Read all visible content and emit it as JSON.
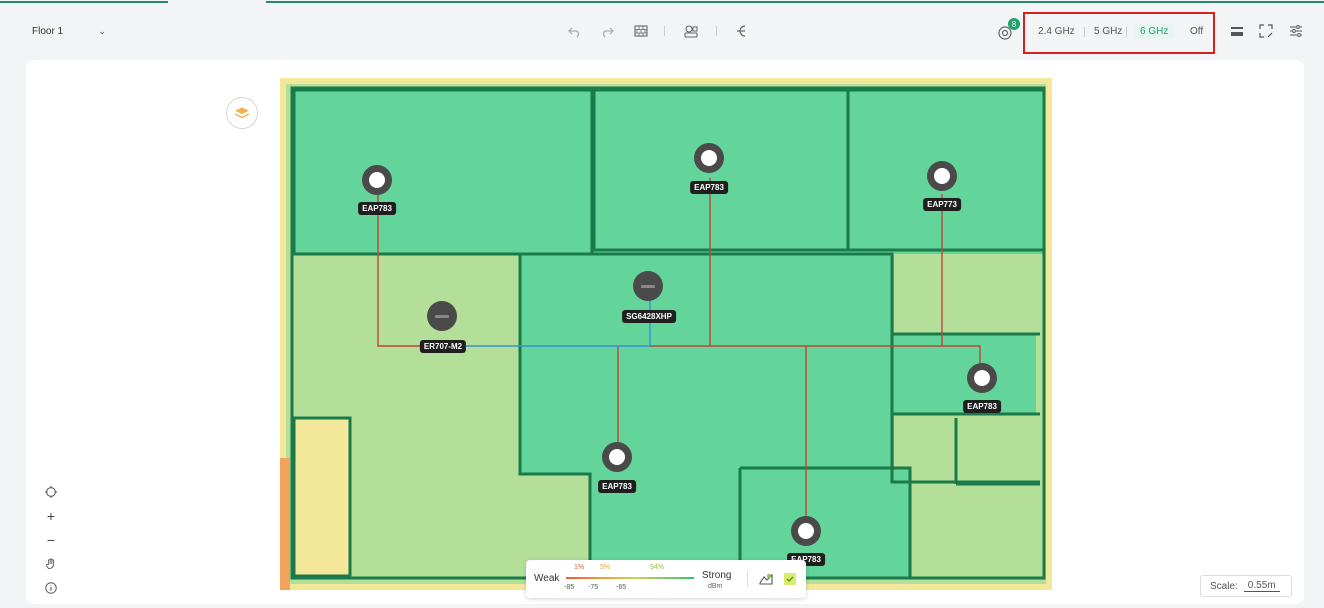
{
  "floor": {
    "label": "Floor 1"
  },
  "toolbar": {
    "badge_count": "8",
    "bands": [
      "2.4 GHz",
      "5 GHz",
      "6 GHz",
      "Off"
    ],
    "active_band": "6 GHz"
  },
  "devices": [
    {
      "label": "EAP783"
    },
    {
      "label": "EAP783"
    },
    {
      "label": "EAP773"
    },
    {
      "label": "ER707-M2"
    },
    {
      "label": "SG6428XHP"
    },
    {
      "label": "EAP783"
    },
    {
      "label": "EAP783"
    },
    {
      "label": "EAP783"
    }
  ],
  "legend": {
    "weak": "Weak",
    "strong": "Strong",
    "unit": "dBm",
    "percents": [
      "1%",
      "5%",
      "94%"
    ],
    "thresholds": [
      "-85",
      "-75",
      "-65"
    ]
  },
  "scale": {
    "label": "Scale:",
    "value": "0.55m"
  },
  "colors": {
    "accent": "#1ea36b",
    "highlight_border": "#d62020",
    "strong_signal": "#64d59a",
    "medium_signal": "#b4df98",
    "weak_signal": "#f3e79a",
    "cable_red": "#c0443a",
    "cable_blue": "#3a8fd8"
  }
}
